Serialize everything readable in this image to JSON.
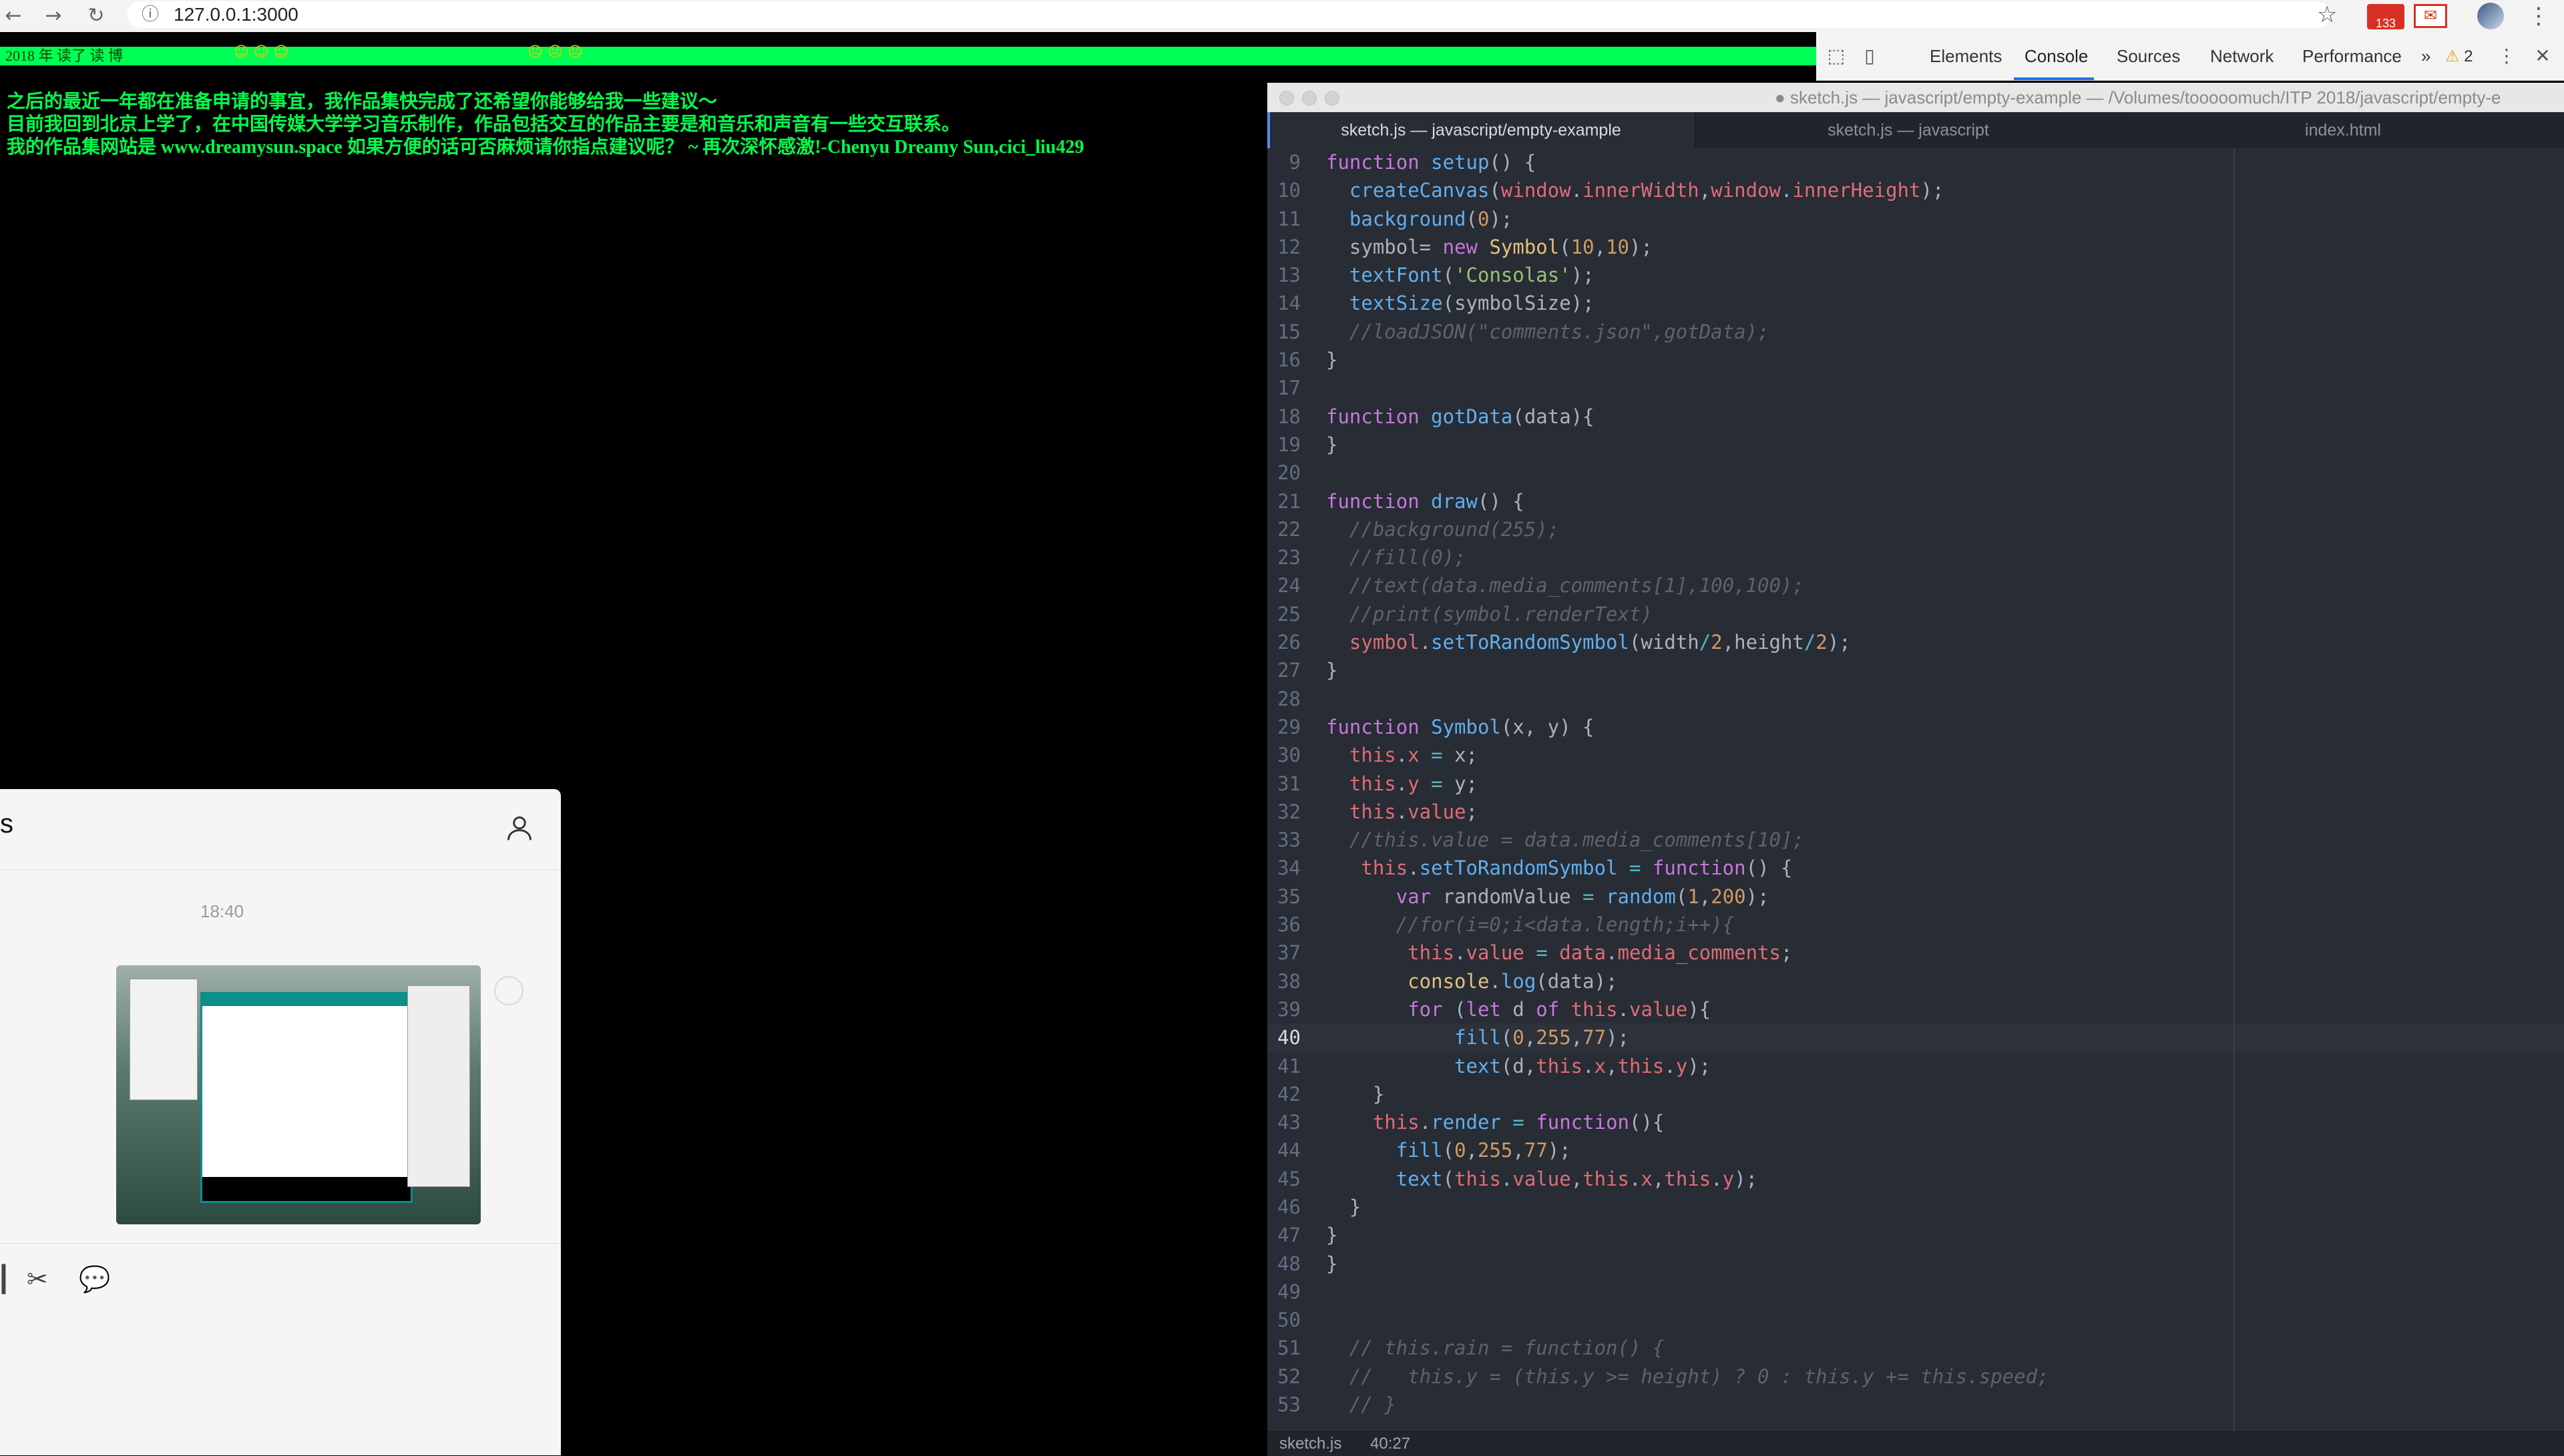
{
  "browser": {
    "url": "127.0.0.1:3000",
    "back_icon": "arrow-left-icon",
    "forward_icon": "arrow-right-icon",
    "reload_icon": "reload-icon",
    "gmail_badge": "133"
  },
  "page": {
    "glitch_text": "2018 年 读了 读 博",
    "messages": [
      "之后的最近一年都在准备申请的事宜，我作品集快完成了还希望你能够给我一些建议～",
      "目前我回到北京上学了，在中国传媒大学学习音乐制作，作品包括交互的作品主要是和音乐和声音有一些交互联系。",
      "我的作品集网站是 www.dreamysun.space 如果方便的话可否麻烦请你指点建议呢？ ~ 再次深怀感激!-Chenyu Dreamy Sun,cici_liu429"
    ],
    "text_color": "#00ff4d"
  },
  "devtools": {
    "tabs": [
      "Elements",
      "Console",
      "Sources",
      "Network",
      "Performance"
    ],
    "active_tab": "Console",
    "overflow": "»",
    "warnings": "2"
  },
  "editor": {
    "title": "sketch.js — javascript/empty-example — /Volumes/tooooomuch/ITP 2018/javascript/empty-e",
    "tabs": [
      "sketch.js — javascript/empty-example",
      "sketch.js — javascript",
      "index.html"
    ],
    "active_tab": 0,
    "current_line": 40,
    "status_file": "sketch.js",
    "status_pos": "40:27",
    "lines": [
      {
        "n": "9",
        "t": [
          [
            "k",
            "function "
          ],
          [
            "f",
            "setup"
          ],
          [
            "p",
            "() {"
          ]
        ]
      },
      {
        "n": "10",
        "t": [
          [
            "p",
            "  "
          ],
          [
            "f",
            "createCanvas"
          ],
          [
            "p",
            "("
          ],
          [
            "v",
            "window"
          ],
          [
            "p",
            "."
          ],
          [
            "v",
            "innerWidth"
          ],
          [
            "p",
            ","
          ],
          [
            "v",
            "window"
          ],
          [
            "p",
            "."
          ],
          [
            "v",
            "innerHeight"
          ],
          [
            "p",
            ");"
          ]
        ]
      },
      {
        "n": "11",
        "t": [
          [
            "p",
            "  "
          ],
          [
            "f",
            "background"
          ],
          [
            "p",
            "("
          ],
          [
            "n",
            "0"
          ],
          [
            "p",
            ");"
          ]
        ]
      },
      {
        "n": "12",
        "t": [
          [
            "p",
            "  symbol= "
          ],
          [
            "k",
            "new "
          ],
          [
            "y",
            "Symbol"
          ],
          [
            "p",
            "("
          ],
          [
            "n",
            "10"
          ],
          [
            "p",
            ","
          ],
          [
            "n",
            "10"
          ],
          [
            "p",
            ");"
          ]
        ]
      },
      {
        "n": "13",
        "t": [
          [
            "p",
            "  "
          ],
          [
            "f",
            "textFont"
          ],
          [
            "p",
            "("
          ],
          [
            "s",
            "'Consolas'"
          ],
          [
            "p",
            ");"
          ]
        ]
      },
      {
        "n": "14",
        "t": [
          [
            "p",
            "  "
          ],
          [
            "f",
            "textSize"
          ],
          [
            "p",
            "(symbolSize);"
          ]
        ]
      },
      {
        "n": "15",
        "t": [
          [
            "c",
            "  //loadJSON(\"comments.json\",gotData);"
          ]
        ]
      },
      {
        "n": "16",
        "t": [
          [
            "p",
            "}"
          ]
        ]
      },
      {
        "n": "17",
        "t": []
      },
      {
        "n": "18",
        "t": [
          [
            "k",
            "function "
          ],
          [
            "f",
            "gotData"
          ],
          [
            "p",
            "(data){"
          ]
        ]
      },
      {
        "n": "19",
        "t": [
          [
            "p",
            "}"
          ]
        ]
      },
      {
        "n": "20",
        "t": []
      },
      {
        "n": "21",
        "t": [
          [
            "k",
            "function "
          ],
          [
            "f",
            "draw"
          ],
          [
            "p",
            "() {"
          ]
        ]
      },
      {
        "n": "22",
        "t": [
          [
            "c",
            "  //background(255);"
          ]
        ]
      },
      {
        "n": "23",
        "t": [
          [
            "c",
            "  //fill(0);"
          ]
        ]
      },
      {
        "n": "24",
        "t": [
          [
            "c",
            "  //text(data.media_comments[1],100,100);"
          ]
        ]
      },
      {
        "n": "25",
        "t": [
          [
            "c",
            "  //print(symbol.renderText)"
          ]
        ]
      },
      {
        "n": "26",
        "t": [
          [
            "p",
            "  "
          ],
          [
            "v",
            "symbol"
          ],
          [
            "p",
            "."
          ],
          [
            "f",
            "setToRandomSymbol"
          ],
          [
            "p",
            "(width"
          ],
          [
            "o",
            "/"
          ],
          [
            "n",
            "2"
          ],
          [
            "p",
            ",height"
          ],
          [
            "o",
            "/"
          ],
          [
            "n",
            "2"
          ],
          [
            "p",
            ");"
          ]
        ]
      },
      {
        "n": "27",
        "t": [
          [
            "p",
            "}"
          ]
        ]
      },
      {
        "n": "28",
        "t": []
      },
      {
        "n": "29",
        "t": [
          [
            "k",
            "function "
          ],
          [
            "f",
            "Symbol"
          ],
          [
            "p",
            "(x, y) {"
          ]
        ]
      },
      {
        "n": "30",
        "t": [
          [
            "p",
            "  "
          ],
          [
            "v",
            "this"
          ],
          [
            "p",
            "."
          ],
          [
            "v",
            "x"
          ],
          [
            "p",
            " "
          ],
          [
            "o",
            "="
          ],
          [
            "p",
            " x;"
          ]
        ]
      },
      {
        "n": "31",
        "t": [
          [
            "p",
            "  "
          ],
          [
            "v",
            "this"
          ],
          [
            "p",
            "."
          ],
          [
            "v",
            "y"
          ],
          [
            "p",
            " "
          ],
          [
            "o",
            "="
          ],
          [
            "p",
            " y;"
          ]
        ]
      },
      {
        "n": "32",
        "t": [
          [
            "p",
            "  "
          ],
          [
            "v",
            "this"
          ],
          [
            "p",
            "."
          ],
          [
            "v",
            "value"
          ],
          [
            "p",
            ";"
          ]
        ]
      },
      {
        "n": "33",
        "t": [
          [
            "c",
            "  //this.value = data.media_comments[10];"
          ]
        ]
      },
      {
        "n": "34",
        "t": [
          [
            "p",
            "   "
          ],
          [
            "v",
            "this"
          ],
          [
            "p",
            "."
          ],
          [
            "f",
            "setToRandomSymbol"
          ],
          [
            "p",
            " "
          ],
          [
            "o",
            "="
          ],
          [
            "p",
            " "
          ],
          [
            "k",
            "function"
          ],
          [
            "p",
            "() {"
          ]
        ]
      },
      {
        "n": "35",
        "t": [
          [
            "p",
            "      "
          ],
          [
            "k",
            "var "
          ],
          [
            "p",
            "randomValue "
          ],
          [
            "o",
            "="
          ],
          [
            "p",
            " "
          ],
          [
            "f",
            "random"
          ],
          [
            "p",
            "("
          ],
          [
            "n",
            "1"
          ],
          [
            "p",
            ","
          ],
          [
            "n",
            "200"
          ],
          [
            "p",
            ");"
          ]
        ]
      },
      {
        "n": "36",
        "t": [
          [
            "c",
            "      //for(i=0;i<data.length;i++){"
          ]
        ]
      },
      {
        "n": "37",
        "t": [
          [
            "p",
            "       "
          ],
          [
            "v",
            "this"
          ],
          [
            "p",
            "."
          ],
          [
            "v",
            "value"
          ],
          [
            "p",
            " "
          ],
          [
            "o",
            "="
          ],
          [
            "p",
            " "
          ],
          [
            "v",
            "data"
          ],
          [
            "p",
            "."
          ],
          [
            "v",
            "media_comments"
          ],
          [
            "p",
            ";"
          ]
        ]
      },
      {
        "n": "38",
        "t": [
          [
            "p",
            "       "
          ],
          [
            "y",
            "console"
          ],
          [
            "p",
            "."
          ],
          [
            "f",
            "log"
          ],
          [
            "p",
            "(data);"
          ]
        ]
      },
      {
        "n": "39",
        "t": [
          [
            "p",
            "       "
          ],
          [
            "k",
            "for "
          ],
          [
            "p",
            "("
          ],
          [
            "k",
            "let "
          ],
          [
            "p",
            "d "
          ],
          [
            "k",
            "of "
          ],
          [
            "v",
            "this"
          ],
          [
            "p",
            "."
          ],
          [
            "v",
            "value"
          ],
          [
            "p",
            "){"
          ]
        ]
      },
      {
        "n": "40",
        "t": [
          [
            "p",
            "           "
          ],
          [
            "f",
            "fill"
          ],
          [
            "p",
            "("
          ],
          [
            "n",
            "0"
          ],
          [
            "p",
            ","
          ],
          [
            "n",
            "255"
          ],
          [
            "p",
            ","
          ],
          [
            "n",
            "77"
          ],
          [
            "p",
            ");"
          ]
        ]
      },
      {
        "n": "41",
        "t": [
          [
            "p",
            "           "
          ],
          [
            "f",
            "text"
          ],
          [
            "p",
            "(d,"
          ],
          [
            "v",
            "this"
          ],
          [
            "p",
            "."
          ],
          [
            "v",
            "x"
          ],
          [
            "p",
            ","
          ],
          [
            "v",
            "this"
          ],
          [
            "p",
            "."
          ],
          [
            "v",
            "y"
          ],
          [
            "p",
            ");"
          ]
        ]
      },
      {
        "n": "42",
        "t": [
          [
            "p",
            "    }"
          ]
        ]
      },
      {
        "n": "43",
        "t": [
          [
            "p",
            "    "
          ],
          [
            "v",
            "this"
          ],
          [
            "p",
            "."
          ],
          [
            "f",
            "render"
          ],
          [
            "p",
            " "
          ],
          [
            "o",
            "="
          ],
          [
            "p",
            " "
          ],
          [
            "k",
            "function"
          ],
          [
            "p",
            "(){"
          ]
        ]
      },
      {
        "n": "44",
        "t": [
          [
            "p",
            "      "
          ],
          [
            "f",
            "fill"
          ],
          [
            "p",
            "("
          ],
          [
            "n",
            "0"
          ],
          [
            "p",
            ","
          ],
          [
            "n",
            "255"
          ],
          [
            "p",
            ","
          ],
          [
            "n",
            "77"
          ],
          [
            "p",
            ");"
          ]
        ]
      },
      {
        "n": "45",
        "t": [
          [
            "p",
            "      "
          ],
          [
            "f",
            "text"
          ],
          [
            "p",
            "("
          ],
          [
            "v",
            "this"
          ],
          [
            "p",
            "."
          ],
          [
            "v",
            "value"
          ],
          [
            "p",
            ","
          ],
          [
            "v",
            "this"
          ],
          [
            "p",
            "."
          ],
          [
            "v",
            "x"
          ],
          [
            "p",
            ","
          ],
          [
            "v",
            "this"
          ],
          [
            "p",
            "."
          ],
          [
            "v",
            "y"
          ],
          [
            "p",
            ");"
          ]
        ]
      },
      {
        "n": "46",
        "t": [
          [
            "p",
            "  }"
          ]
        ]
      },
      {
        "n": "47",
        "t": [
          [
            "p",
            "}"
          ]
        ]
      },
      {
        "n": "48",
        "t": [
          [
            "p",
            "}"
          ]
        ]
      },
      {
        "n": "49",
        "t": []
      },
      {
        "n": "50",
        "t": []
      },
      {
        "n": "51",
        "t": [
          [
            "c",
            "  // this.rain = function() {"
          ]
        ]
      },
      {
        "n": "52",
        "t": [
          [
            "c",
            "  //   this.y = (this.y >= height) ? 0 : this.y += this.speed;"
          ]
        ]
      },
      {
        "n": "53",
        "t": [
          [
            "c",
            "  // }"
          ]
        ]
      }
    ]
  },
  "chat": {
    "title": "s",
    "time": "18:40",
    "tools": [
      "┃",
      "✂",
      "💬"
    ]
  }
}
